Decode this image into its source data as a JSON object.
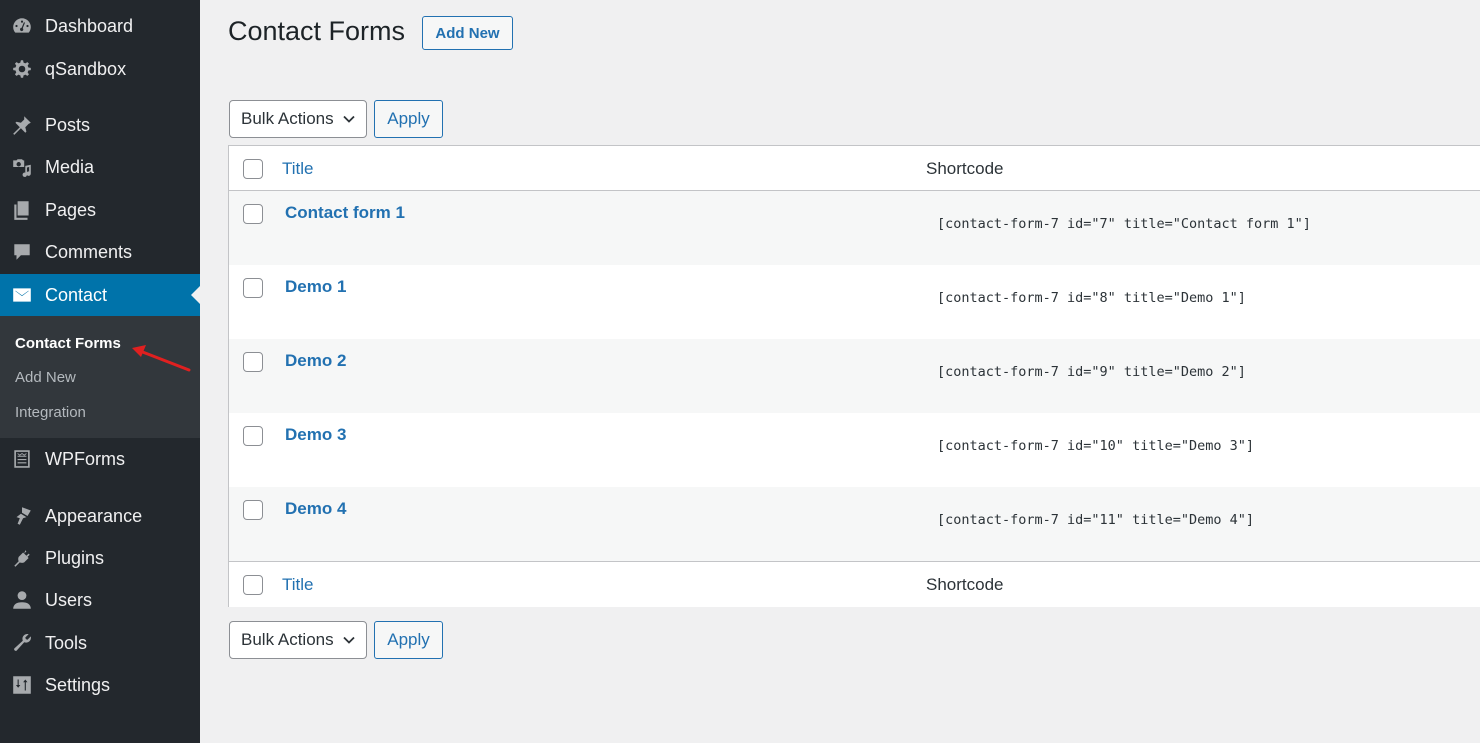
{
  "sidebar": {
    "items": [
      {
        "label": "Dashboard",
        "icon": "dashboard-icon"
      },
      {
        "label": "qSandbox",
        "icon": "gear-icon"
      },
      {
        "label": "Posts",
        "icon": "pin-icon"
      },
      {
        "label": "Media",
        "icon": "media-icon"
      },
      {
        "label": "Pages",
        "icon": "pages-icon"
      },
      {
        "label": "Comments",
        "icon": "comment-icon"
      },
      {
        "label": "Contact",
        "icon": "envelope-icon",
        "active": true
      },
      {
        "label": "WPForms",
        "icon": "form-icon"
      },
      {
        "label": "Appearance",
        "icon": "paintbrush-icon"
      },
      {
        "label": "Plugins",
        "icon": "plug-icon"
      },
      {
        "label": "Users",
        "icon": "user-icon"
      },
      {
        "label": "Tools",
        "icon": "wrench-icon"
      },
      {
        "label": "Settings",
        "icon": "sliders-icon"
      }
    ],
    "submenu": [
      {
        "label": "Contact Forms",
        "current": true
      },
      {
        "label": "Add New"
      },
      {
        "label": "Integration"
      }
    ]
  },
  "header": {
    "title": "Contact Forms",
    "add_new_label": "Add New"
  },
  "bulk_actions": {
    "selected": "Bulk Actions",
    "apply_label": "Apply"
  },
  "table": {
    "columns": {
      "title": "Title",
      "shortcode": "Shortcode"
    },
    "rows": [
      {
        "title": "Contact form 1",
        "shortcode": "[contact-form-7 id=\"7\" title=\"Contact form 1\"]"
      },
      {
        "title": "Demo 1",
        "shortcode": "[contact-form-7 id=\"8\" title=\"Demo 1\"]"
      },
      {
        "title": "Demo 2",
        "shortcode": "[contact-form-7 id=\"9\" title=\"Demo 2\"]"
      },
      {
        "title": "Demo 3",
        "shortcode": "[contact-form-7 id=\"10\" title=\"Demo 3\"]"
      },
      {
        "title": "Demo 4",
        "shortcode": "[contact-form-7 id=\"11\" title=\"Demo 4\"]"
      }
    ]
  },
  "colors": {
    "sidebar_bg": "#23282d",
    "submenu_bg": "#32373c",
    "active_bg": "#0073aa",
    "link": "#2271b1",
    "annotation_arrow": "#e02020"
  }
}
